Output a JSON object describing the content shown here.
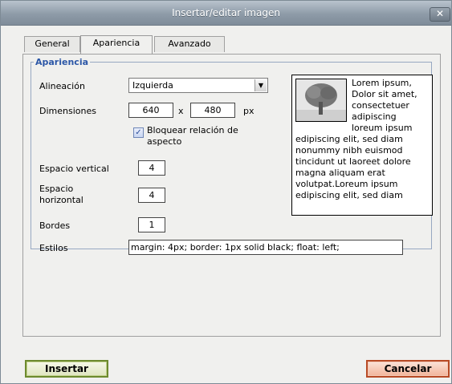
{
  "window": {
    "title": "Insertar/editar imagen",
    "close_label": "✕"
  },
  "tabs": [
    {
      "label": "General"
    },
    {
      "label": "Apariencia",
      "active": true
    },
    {
      "label": "Avanzado"
    }
  ],
  "appearance": {
    "legend": "Apariencia",
    "alignment": {
      "label": "Alineación",
      "value": "Izquierda"
    },
    "dimensions": {
      "label": "Dimensiones",
      "width": "640",
      "separator": "x",
      "height": "480",
      "unit": "px"
    },
    "lock_ratio": {
      "label": "Bloquear relación de aspecto",
      "checked": true
    },
    "vspace": {
      "label": "Espacio vertical",
      "value": "4"
    },
    "hspace": {
      "label": "Espacio horizontal",
      "value": "4"
    },
    "border": {
      "label": "Bordes",
      "value": "1"
    },
    "styles": {
      "label": "Estilos",
      "value": "margin: 4px; border: 1px solid black; float: left;"
    },
    "preview_text": "Lorem ipsum, Dolor sit amet, consectetuer adipiscing loreum ipsum edipiscing elit, sed diam nonummy nibh euismod tincidunt ut laoreet dolore magna aliquam erat volutpat.Loreum ipsum edipiscing elit, sed diam"
  },
  "buttons": {
    "insert": "Insertar",
    "cancel": "Cancelar"
  },
  "colors": {
    "legend": "#2c57a7",
    "titlebar": "#8e9ba8",
    "insert_border": "#6d8a2e",
    "cancel_border": "#b84a25"
  }
}
